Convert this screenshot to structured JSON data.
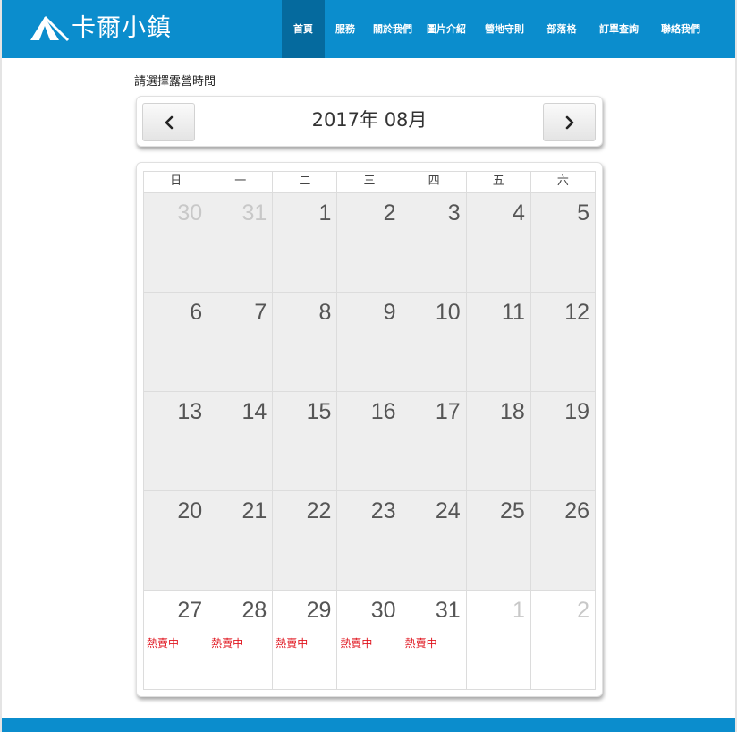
{
  "site": {
    "name": "卡爾小鎮"
  },
  "nav": [
    {
      "label": "首頁",
      "active": true
    },
    {
      "label": "服務",
      "active": false
    },
    {
      "label": "關於我們",
      "active": false
    },
    {
      "label": "圖片介紹",
      "active": false
    },
    {
      "label": "營地守則",
      "active": false
    },
    {
      "label": "部落格",
      "active": false
    },
    {
      "label": "訂單查詢",
      "active": false
    },
    {
      "label": "聯絡我們",
      "active": false
    }
  ],
  "booking": {
    "title": "請選擇露營時間",
    "month_label": "2017年 08月",
    "prev_label": "‹",
    "next_label": "›"
  },
  "calendar": {
    "weekdays": [
      "日",
      "一",
      "二",
      "三",
      "四",
      "五",
      "六"
    ],
    "hot_label": "熱賣中",
    "days": [
      {
        "num": "30",
        "other": true,
        "avail": false,
        "hot": false
      },
      {
        "num": "31",
        "other": true,
        "avail": false,
        "hot": false
      },
      {
        "num": "1",
        "other": false,
        "avail": false,
        "hot": false
      },
      {
        "num": "2",
        "other": false,
        "avail": false,
        "hot": false
      },
      {
        "num": "3",
        "other": false,
        "avail": false,
        "hot": false
      },
      {
        "num": "4",
        "other": false,
        "avail": false,
        "hot": false
      },
      {
        "num": "5",
        "other": false,
        "avail": false,
        "hot": false
      },
      {
        "num": "6",
        "other": false,
        "avail": false,
        "hot": false
      },
      {
        "num": "7",
        "other": false,
        "avail": false,
        "hot": false
      },
      {
        "num": "8",
        "other": false,
        "avail": false,
        "hot": false
      },
      {
        "num": "9",
        "other": false,
        "avail": false,
        "hot": false
      },
      {
        "num": "10",
        "other": false,
        "avail": false,
        "hot": false
      },
      {
        "num": "11",
        "other": false,
        "avail": false,
        "hot": false
      },
      {
        "num": "12",
        "other": false,
        "avail": false,
        "hot": false
      },
      {
        "num": "13",
        "other": false,
        "avail": false,
        "hot": false
      },
      {
        "num": "14",
        "other": false,
        "avail": false,
        "hot": false
      },
      {
        "num": "15",
        "other": false,
        "avail": false,
        "hot": false
      },
      {
        "num": "16",
        "other": false,
        "avail": false,
        "hot": false
      },
      {
        "num": "17",
        "other": false,
        "avail": false,
        "hot": false
      },
      {
        "num": "18",
        "other": false,
        "avail": false,
        "hot": false
      },
      {
        "num": "19",
        "other": false,
        "avail": false,
        "hot": false
      },
      {
        "num": "20",
        "other": false,
        "avail": false,
        "hot": false
      },
      {
        "num": "21",
        "other": false,
        "avail": false,
        "hot": false
      },
      {
        "num": "22",
        "other": false,
        "avail": false,
        "hot": false
      },
      {
        "num": "23",
        "other": false,
        "avail": false,
        "hot": false
      },
      {
        "num": "24",
        "other": false,
        "avail": false,
        "hot": false
      },
      {
        "num": "25",
        "other": false,
        "avail": false,
        "hot": false
      },
      {
        "num": "26",
        "other": false,
        "avail": false,
        "hot": false
      },
      {
        "num": "27",
        "other": false,
        "avail": true,
        "hot": true
      },
      {
        "num": "28",
        "other": false,
        "avail": true,
        "hot": true
      },
      {
        "num": "29",
        "other": false,
        "avail": true,
        "hot": true
      },
      {
        "num": "30",
        "other": false,
        "avail": true,
        "hot": true
      },
      {
        "num": "31",
        "other": false,
        "avail": true,
        "hot": true
      },
      {
        "num": "1",
        "other": true,
        "avail": true,
        "hot": false
      },
      {
        "num": "2",
        "other": true,
        "avail": true,
        "hot": false
      }
    ]
  },
  "colors": {
    "brand_blue": "#0b8dcd",
    "nav_active": "#056a9e",
    "hot_red": "#e0141e",
    "unavailable_day": "#eeeeee"
  }
}
